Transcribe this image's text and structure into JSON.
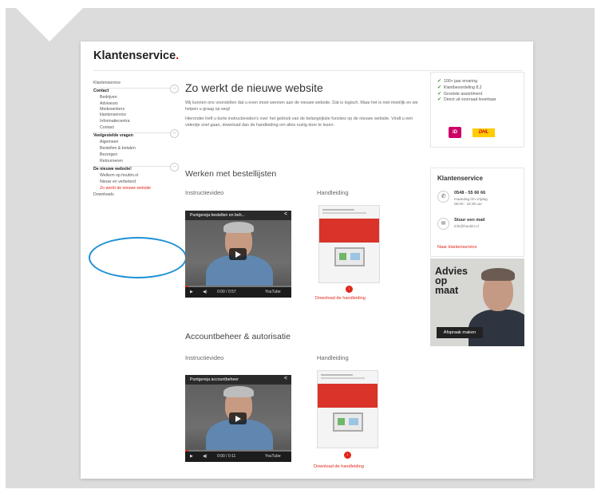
{
  "brand": {
    "name": "Klantenservice",
    "dot": "."
  },
  "nav": {
    "items": [
      {
        "label": "Klantenservice",
        "kind": "top"
      },
      {
        "label": "Contact",
        "kind": "bold"
      },
      {
        "label": "Bedrijven",
        "kind": "sub"
      },
      {
        "label": "Adviseurs",
        "kind": "sub"
      },
      {
        "label": "Medewerkers klantenservice",
        "kind": "sub"
      },
      {
        "label": "Informatiecentra",
        "kind": "sub"
      },
      {
        "label": "Contact",
        "kind": "sub"
      },
      {
        "label": "Veelgestelde vragen",
        "kind": "bold"
      },
      {
        "label": "Algemeen",
        "kind": "sub"
      },
      {
        "label": "Bestellen & betalen",
        "kind": "sub"
      },
      {
        "label": "Bezorgen",
        "kind": "sub"
      },
      {
        "label": "Retourneren",
        "kind": "sub"
      },
      {
        "label": "De nieuwe website!",
        "kind": "bold"
      },
      {
        "label": "Welkom op houtim.nl",
        "kind": "sub"
      },
      {
        "label": "Nieuw en verbeterd",
        "kind": "sub"
      },
      {
        "label": "Zo werkt de nieuwe website",
        "kind": "active"
      },
      {
        "label": "Downloads",
        "kind": "top"
      }
    ]
  },
  "main": {
    "title": "Zo werkt de nieuwe website",
    "intro": "Wij kunnen ons voorstellen dat u even moet wennen aan de nieuwe website. Dat is logisch. Maar het is niet moeilijk en we helpen u graag op weg!",
    "intro2": "Hieronder treft u korte instructievideo's over het gebruik van de belangrijkste functies op de nieuwe website. Vindt u een videotje snel gaan, download dan de handleiding om alles rustig door te lezen.",
    "sections": [
      {
        "heading": "Werken met bestellijsten",
        "video_label": "Instructievideo",
        "video_title": "Puntgereja bestellen en beh...",
        "video_time": "0:00 / 0:57",
        "manual_label": "Handleiding",
        "download": "Download de handleiding"
      },
      {
        "heading": "Accountbeheer & autorisatie",
        "video_label": "Instructievideo",
        "video_title": "Puntgereja accountbeheer",
        "video_time": "0:00 / 0:11",
        "manual_label": "Handleiding",
        "download": "Download de handleiding"
      }
    ]
  },
  "usps": [
    "100+ jaar ervaring",
    "Klantbeoordeling 8,2",
    "Grootste assortiment",
    "Direct uit voorraad leverbaar"
  ],
  "payment_logos": {
    "ideal": "iD",
    "dhl": "DHL"
  },
  "klantenservice": {
    "title": "Klantenservice",
    "phone": "0548 - 55 66 66",
    "phone_hours": "maandag t/m vrijdag",
    "phone_hours2": "08:00 - 16:30 uur",
    "mail_title": "Stuur een mail",
    "mail_address": "info@houtim.nl",
    "link": "Naar klantenservice"
  },
  "advice": {
    "title": "Advies\nop\nmaat",
    "button": "Afspraak maken"
  },
  "colors": {
    "accent": "#e0261a",
    "annotation": "#1e90d6",
    "check": "#3c9a2b"
  },
  "icons": {
    "share": "share-icon",
    "play": "play-icon",
    "pdf": "pdf-icon",
    "phone": "phone-icon",
    "mail": "mail-icon"
  }
}
